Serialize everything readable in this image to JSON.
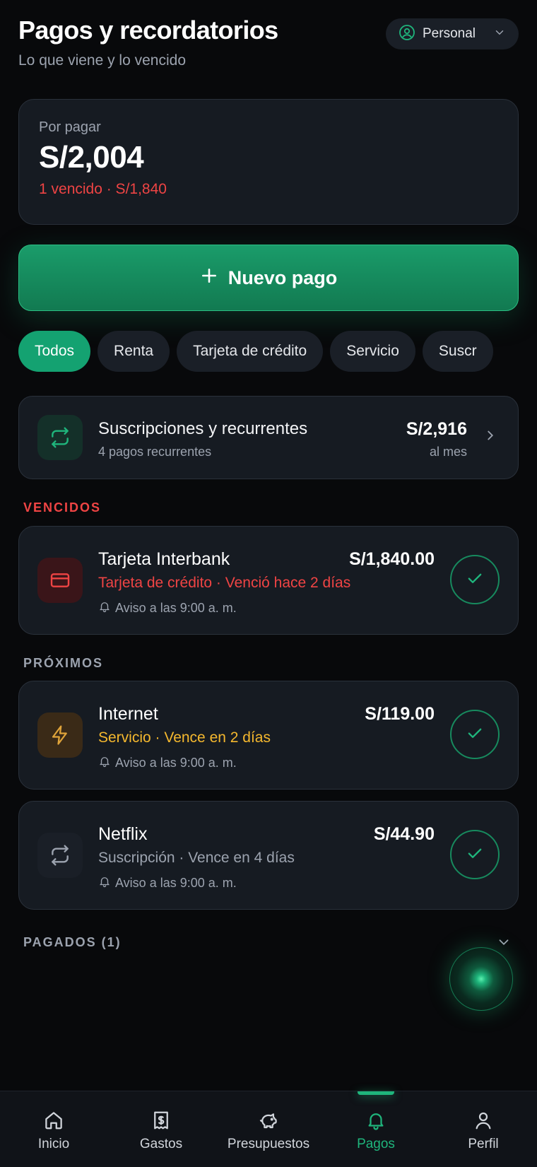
{
  "header": {
    "title": "Pagos y recordatorios",
    "subtitle": "Lo que viene y lo vencido",
    "account": {
      "label": "Personal",
      "icon": "user-circle-icon"
    }
  },
  "summary": {
    "label": "Por pagar",
    "amount": "S/2,004",
    "overdue": "1 vencido · S/1,840"
  },
  "new_payment": {
    "label": "Nuevo pago",
    "icon": "plus-icon"
  },
  "filters": [
    "Todos",
    "Renta",
    "Tarjeta de crédito",
    "Servicio",
    "Suscr"
  ],
  "subscriptions": {
    "title": "Suscripciones y recurrentes",
    "subtitle": "4 pagos recurrentes",
    "amount": "S/2,916",
    "period": "al mes"
  },
  "sections": {
    "overdue": "VENCIDOS",
    "upcoming": "PRÓXIMOS",
    "paid": "PAGADOS (1)"
  },
  "overdue_items": [
    {
      "name": "Tarjeta Interbank",
      "meta": "Tarjeta de crédito · Venció hace 2 días",
      "amount": "S/1,840.00",
      "reminder": "Aviso a las 9:00 a. m.",
      "icon": "credit-card-icon",
      "meta_color": "#ef4444",
      "icon_bg": "#3a1519",
      "icon_color": "#ef4444"
    }
  ],
  "upcoming_items": [
    {
      "name": "Internet",
      "meta": "Servicio · Vence en 2 días",
      "amount": "S/119.00",
      "reminder": "Aviso a las 9:00 a. m.",
      "icon": "lightning-icon",
      "meta_color": "#f5b82e",
      "icon_bg": "#3a2a17",
      "icon_color": "#e0a43a"
    },
    {
      "name": "Netflix",
      "meta": "Suscripción · Vence en 4 días",
      "amount": "S/44.90",
      "reminder": "Aviso a las 9:00 a. m.",
      "icon": "repeat-icon",
      "meta_color": "#9ca3af",
      "icon_bg": "#1a1f27",
      "icon_color": "#9ca3af"
    }
  ],
  "tabs": [
    {
      "label": "Inicio",
      "icon": "home-icon",
      "active": false
    },
    {
      "label": "Gastos",
      "icon": "receipt-icon",
      "active": false
    },
    {
      "label": "Presupuestos",
      "icon": "piggy-bank-icon",
      "active": false
    },
    {
      "label": "Pagos",
      "icon": "bell-icon",
      "active": true
    },
    {
      "label": "Perfil",
      "icon": "user-icon",
      "active": false
    }
  ],
  "colors": {
    "accent": "#1fb57c",
    "danger": "#ef4444",
    "warning": "#f5b82e"
  }
}
